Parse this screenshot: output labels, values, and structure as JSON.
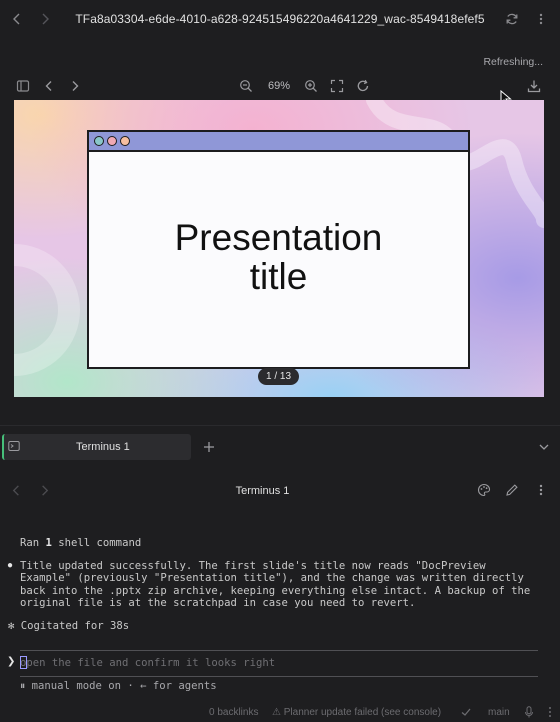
{
  "window": {
    "title": "TFa8a03304-e6de-4010-a628-924515496220a4641229_wac-8549418efef5",
    "refresh_status": "Refreshing..."
  },
  "preview": {
    "zoom": "69%",
    "slide": {
      "title_line1": "Presentation",
      "title_line2": "title"
    },
    "page_indicator": "1 / 13"
  },
  "terminal_tabs": {
    "active_tab": "Terminus 1"
  },
  "terminal": {
    "header_title": "Terminus 1",
    "ran_prefix": "Ran ",
    "ran_count": "1",
    "ran_suffix": " shell command",
    "message": "Title updated successfully. The first slide's title now reads \"DocPreview\nExample\" (previously \"Presentation title\"), and the change was written directly\nback into the .pptx zip archive, keeping everything else intact. A backup of the\noriginal file is at the scratchpad in case you need to revert.",
    "cogitated": "✻ Cogitated for 38s",
    "prompt_placeholder": "open the file and confirm it looks right",
    "mode_line": "⏸ manual mode on · ← for agents"
  },
  "statusbar": {
    "backlinks": "0 backlinks",
    "warning": "⚠ Planner update failed (see console)",
    "branch": "main"
  },
  "colors": {
    "accent_green": "#46c07a",
    "slide_titlebar": "#8f97d7",
    "dot_1": "#89c6c9",
    "dot_2": "#f0a9b4",
    "dot_3": "#f6bfa0"
  }
}
